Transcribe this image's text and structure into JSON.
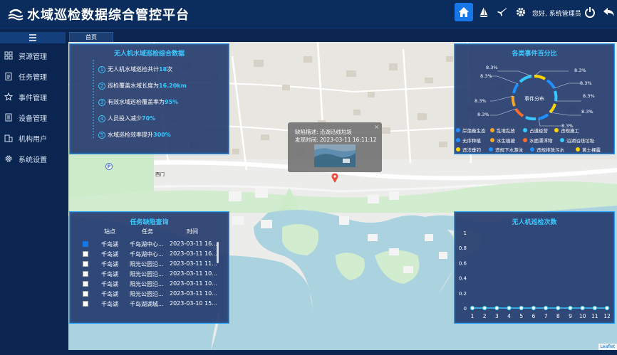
{
  "app": {
    "title": "水域巡检数据综合管控平台"
  },
  "header": {
    "greeting": "您好, 系统管理员"
  },
  "sidebar": {
    "items": [
      {
        "label": "资源管理",
        "icon": "grid-icon"
      },
      {
        "label": "任务管理",
        "icon": "clipboard-icon"
      },
      {
        "label": "事件管理",
        "icon": "star-icon"
      },
      {
        "label": "设备管理",
        "icon": "server-icon"
      },
      {
        "label": "机构用户",
        "icon": "org-icon"
      },
      {
        "label": "系统设置",
        "icon": "gear-icon"
      }
    ]
  },
  "tabs": [
    {
      "label": "首页"
    }
  ],
  "stats": {
    "title": "无人机水域巡检综合数据",
    "items": [
      {
        "num": "1",
        "prefix": "无人机水域巡检共计",
        "value": "18",
        "suffix": "次"
      },
      {
        "num": "2",
        "prefix": "巡检覆盖水域长度为",
        "value": "16.20km",
        "suffix": ""
      },
      {
        "num": "3",
        "prefix": "有效水域巡检覆盖率为",
        "value": "95%",
        "suffix": ""
      },
      {
        "num": "4",
        "prefix": "人员投入减少",
        "value": "70%",
        "suffix": ""
      },
      {
        "num": "5",
        "prefix": "水域巡检效率提升",
        "value": "300%",
        "suffix": ""
      }
    ]
  },
  "events": {
    "title": "各类事件百分比",
    "center_label": "事件分布",
    "percent_label": "8.3%",
    "legend": [
      {
        "label": "岸藻蔽生态",
        "color": "#1e90ff"
      },
      {
        "label": "乱堆乱放",
        "color": "#f5a623"
      },
      {
        "label": "占道经营",
        "color": "#35c9ff"
      },
      {
        "label": "违规施工",
        "color": "#ffd400"
      },
      {
        "label": "无序种植",
        "color": "#1e90ff"
      },
      {
        "label": "水生植被",
        "color": "#f5a623"
      },
      {
        "label": "水面漂浮物",
        "color": "#ff6b2b"
      },
      {
        "label": "沿湖沿线垃圾",
        "color": "#35c9ff"
      },
      {
        "label": "违法垂钓",
        "color": "#ffd400"
      },
      {
        "label": "违规下水游泳",
        "color": "#1e90ff"
      },
      {
        "label": "违规排放污水",
        "color": "#1e90ff"
      },
      {
        "label": "黄土裸露",
        "color": "#ffd400"
      }
    ]
  },
  "tasks": {
    "title": "任务缺陷查询",
    "columns": [
      "站点",
      "任务",
      "时间"
    ],
    "rows": [
      {
        "site": "千岛湖",
        "task": "千岛湖中心...",
        "time": "2023-03-11 16...",
        "checked": true
      },
      {
        "site": "千岛湖",
        "task": "千岛湖中心...",
        "time": "2023-03-11 16...",
        "checked": false
      },
      {
        "site": "千岛湖",
        "task": "阳光公园沿...",
        "time": "2023-03-11 11...",
        "checked": false
      },
      {
        "site": "千岛湖",
        "task": "阳光公园沿...",
        "time": "2023-03-11 10...",
        "checked": false
      },
      {
        "site": "千岛湖",
        "task": "阳光公园沿...",
        "time": "2023-03-11 10...",
        "checked": false
      },
      {
        "site": "千岛湖",
        "task": "阳光公园沿...",
        "time": "2023-03-11 10...",
        "checked": false
      },
      {
        "site": "千岛湖",
        "task": "千岛湖湖城...",
        "time": "2023-03-10 15...",
        "checked": false
      }
    ]
  },
  "chart_data": {
    "type": "line",
    "title": "无人机巡检次数",
    "x": [
      1,
      2,
      3,
      4,
      5,
      6,
      7,
      8,
      9,
      10,
      11,
      12
    ],
    "series": [
      {
        "values": [
          0,
          0,
          0,
          0,
          0,
          0,
          0,
          0,
          0,
          0,
          0,
          0
        ]
      }
    ],
    "ylim": [
      0,
      1
    ],
    "yticks": [
      "1",
      "0.8",
      "0.6",
      "0.4",
      "0.2",
      "0"
    ],
    "color": "#35c9ff"
  },
  "popup": {
    "line1": "缺陷描述: 沿湖沿线垃圾",
    "line2": "发现时间: 2023-03-11 16:11:12",
    "close": "×"
  },
  "map": {
    "labels": [
      "西门",
      "P"
    ],
    "attribution": "Leaflet"
  }
}
